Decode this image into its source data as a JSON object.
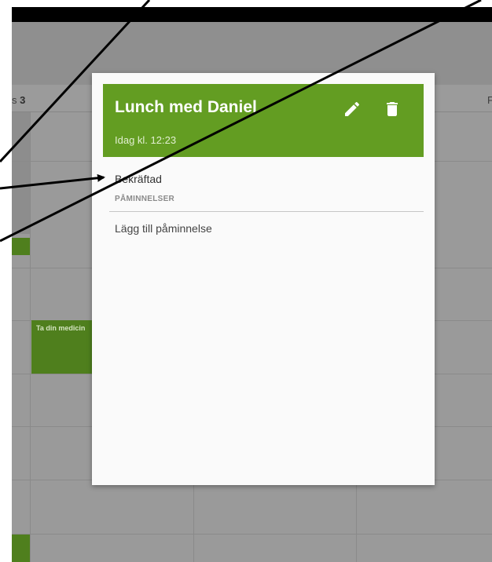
{
  "calendar": {
    "day_label_left": "s",
    "day_number_left": "3",
    "day_label_right": "F",
    "event_title": "Ta din medicin"
  },
  "popup": {
    "title": "Lunch med Daniel",
    "time": "Idag kl. 12:23",
    "edit_icon": "pencil-icon",
    "delete_icon": "trash-icon",
    "status": "Bekräftad",
    "reminders_label": "PÅMINNELSER",
    "add_reminder": "Lägg till påminnelse"
  },
  "colors": {
    "header_green": "#639d22",
    "event_green": "#4f7f1d"
  }
}
